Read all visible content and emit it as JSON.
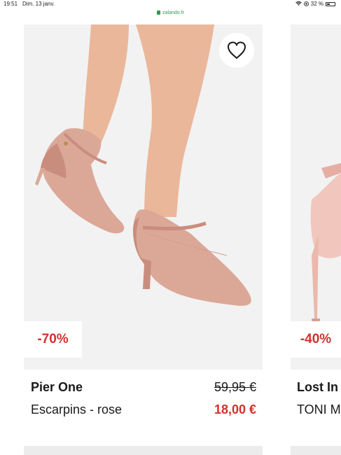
{
  "status_bar": {
    "time": "19:51",
    "date": "Dim. 13 janv.",
    "battery": "32 %",
    "icons": [
      "wifi-icon",
      "location-icon",
      "battery-icon"
    ]
  },
  "browser": {
    "url": "zalando.fr"
  },
  "products": [
    {
      "discount": "-70%",
      "brand": "Pier One",
      "name": "Escarpins - rose",
      "original_price": "59,95 €",
      "sale_price": "18,00 €",
      "wishlist_icon": "heart-outline-icon"
    },
    {
      "discount": "-40%",
      "brand": "Lost In",
      "name": "TONI M"
    }
  ],
  "colors": {
    "sale_red": "#d0312d",
    "text_dark": "#1a1a1a",
    "image_background": "#f2f2f2",
    "secure_green": "#2e9b4f"
  }
}
